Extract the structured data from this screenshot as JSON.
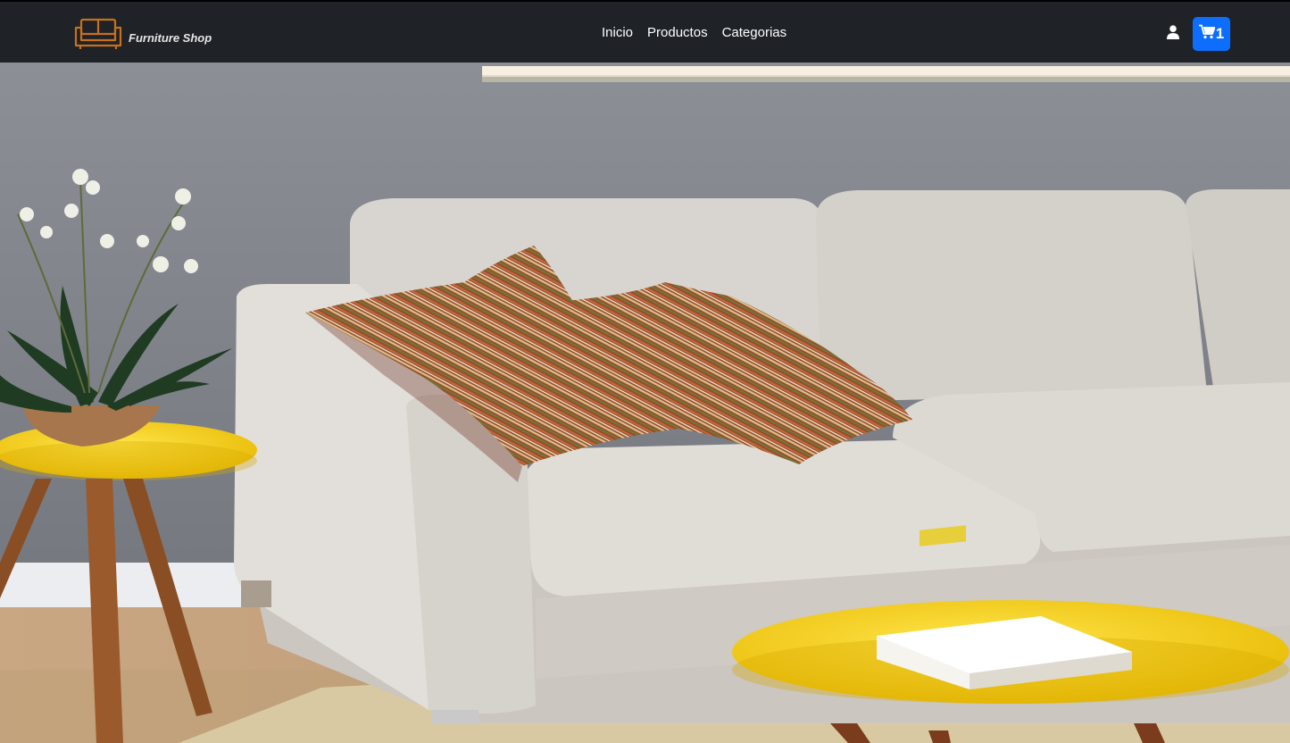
{
  "navbar": {
    "brand_name": "Furniture Shop",
    "links": [
      {
        "label": "Inicio"
      },
      {
        "label": "Productos"
      },
      {
        "label": "Categorias"
      }
    ],
    "user_icon": "user-icon",
    "cart": {
      "icon": "shopping-cart-icon",
      "count": "1",
      "color": "#0d6efd"
    },
    "logo_icon": "sofa-icon",
    "logo_color": "#c8701c",
    "background": "#1f2227"
  },
  "hero": {
    "image": "living room with white sofa, striped cushions and yellow side tables"
  }
}
